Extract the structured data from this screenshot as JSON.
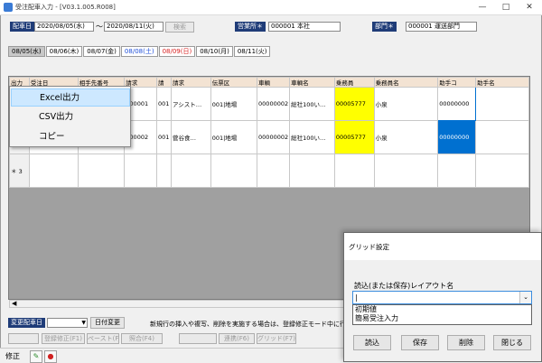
{
  "window": {
    "title": "受注配車入力 - [V03.1.005.R008]"
  },
  "header": {
    "dispatch_date_label": "配車日",
    "date_from": "2020/08/05(水)",
    "range_sep": "～",
    "date_to": "2020/08/11(火)",
    "search_button": "検索",
    "office_label": "営業所＊",
    "office_value": "000001 本社",
    "dept_label": "部門＊",
    "dept_value": "000001 運送部門"
  },
  "date_tabs": [
    {
      "label": "08/05(水)",
      "color": "#000000"
    },
    {
      "label": "08/06(木)",
      "color": "#000000"
    },
    {
      "label": "08/07(金)",
      "color": "#000000"
    },
    {
      "label": "08/08(土)",
      "color": "#1f4fd8"
    },
    {
      "label": "08/09(日)",
      "color": "#d81f1f"
    },
    {
      "label": "08/10(月)",
      "color": "#000000"
    },
    {
      "label": "08/11(火)",
      "color": "#000000"
    }
  ],
  "grid": {
    "columns": [
      "出力",
      "受注日",
      "相手先番号",
      "請求",
      "請",
      "請求",
      "伝票区",
      "車輌",
      "車輌名",
      "乗務員",
      "乗務員名",
      "助手コ",
      "助手名"
    ],
    "rows": [
      {
        "c3": "000001",
        "c4": "001",
        "c5": "アシスト…",
        "c6": "001|地場",
        "c7": "00000002",
        "c8": "総社100い…",
        "c9": "00005777",
        "c10": "小泉",
        "c11": "00000000"
      },
      {
        "c3": "000002",
        "c4": "001",
        "c5": "菅谷食…",
        "c6": "001|地場",
        "c7": "00000002",
        "c8": "総社100い…",
        "c9": "00005777",
        "c10": "小泉",
        "c11": "00000000"
      }
    ],
    "new_row_marker": "＊",
    "new_row_number": "3"
  },
  "context_menu": {
    "items": [
      "Excel出力",
      "CSV出力",
      "コピー"
    ]
  },
  "bottom": {
    "change_date_label": "変更配車日",
    "change_date_button": "日付変更",
    "notice": "新規行の挿入や複写、削除を実施する場合は、登録修正モード中に行",
    "func_buttons": [
      "",
      "登録修正(F1)",
      "ペースト(F3)",
      "照合(F4)",
      "",
      "連携(F6)",
      "グリッド(F7)"
    ],
    "mode": "修正"
  },
  "dialog": {
    "title": "グリッド設定",
    "layout_label": "読込(または保存)レイアウト名",
    "combo_value": "|",
    "options": [
      "初期値",
      "簡易受注入力"
    ],
    "buttons": [
      "読込",
      "保存",
      "削除",
      "閉じる"
    ]
  },
  "colors": {
    "header_label_bg": "#1f3c78",
    "highlight_yellow": "#ffff00",
    "selected_blue": "#0070d0"
  }
}
